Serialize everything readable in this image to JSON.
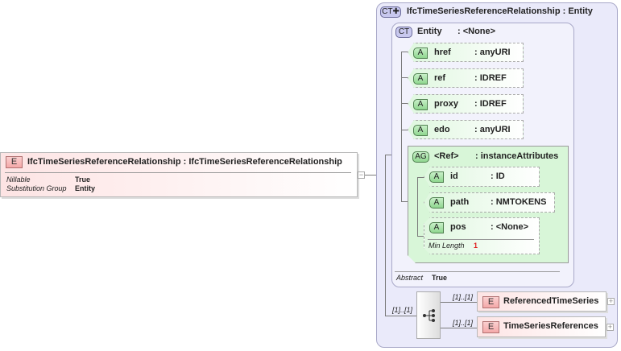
{
  "root": {
    "badge": "E",
    "name": "IfcTimeSeriesReferenceRelationship",
    "type": "IfcTimeSeriesReferenceRelationship",
    "sep": ":",
    "props": [
      {
        "label": "Nillable",
        "value": "True"
      },
      {
        "label": "Substitution Group",
        "value": "Entity"
      }
    ],
    "collapse": "−"
  },
  "complex_type": {
    "badge": "CT✚",
    "name": "IfcTimeSeriesReferenceRelationship",
    "type": "Entity",
    "sep": ":"
  },
  "base": {
    "badge": "CT",
    "name": "Entity",
    "type": ": <None>",
    "attributes": [
      {
        "badge": "A",
        "name": "href",
        "type": ": anyURI"
      },
      {
        "badge": "A",
        "name": "ref",
        "type": ": IDREF"
      },
      {
        "badge": "A",
        "name": "proxy",
        "type": ": IDREF"
      },
      {
        "badge": "A",
        "name": "edo",
        "type": ": anyURI"
      }
    ],
    "group": {
      "badge": "AG",
      "name": "<Ref>",
      "type": ": instanceAttributes",
      "attributes": [
        {
          "badge": "A",
          "name": "id",
          "type": ": ID"
        },
        {
          "badge": "A",
          "name": "path",
          "type": ": NMTOKENS"
        },
        {
          "badge": "A",
          "name": "pos",
          "type": ": <None>",
          "facet_label": "Min Length",
          "facet_value": "1"
        }
      ]
    },
    "abstract_label": "Abstract",
    "abstract_value": "True"
  },
  "sequence": {
    "cardinality": "[1]..[1]",
    "children": [
      {
        "badge": "E",
        "name": "ReferencedTimeSeries",
        "cardinality": "[1]..[1]",
        "expand": "+"
      },
      {
        "badge": "E",
        "name": "TimeSeriesReferences",
        "cardinality": "[1]..[1]",
        "expand": "+"
      }
    ]
  },
  "colors": {
    "element": "#fde4e4",
    "attribute": "#dff7df",
    "complex_type": "#eaeafa"
  }
}
